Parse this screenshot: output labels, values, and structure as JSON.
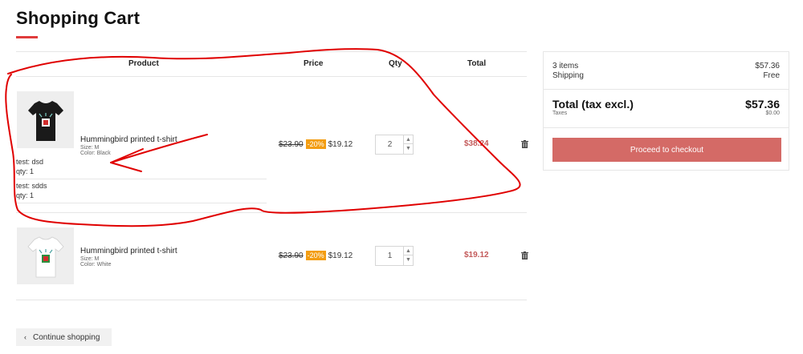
{
  "page": {
    "title": "Shopping Cart"
  },
  "table": {
    "headers": {
      "product": "Product",
      "price": "Price",
      "qty": "Qty",
      "total": "Total"
    }
  },
  "items": [
    {
      "name": "Hummingbird printed t-shirt",
      "size": "Size: M",
      "color": "Color: Black",
      "shirt_color": "#1a1a1a",
      "customizations": [
        {
          "label": "test: dsd",
          "qty": "qty: 1"
        },
        {
          "label": "test: sdds",
          "qty": "qty: 1"
        }
      ],
      "old_price": "$23.90",
      "discount": "-20%",
      "new_price": "$19.12",
      "quantity": "2",
      "line_total": "$38.24"
    },
    {
      "name": "Hummingbird printed t-shirt",
      "size": "Size: M",
      "color": "Color: White",
      "shirt_color": "#f4f4f4",
      "old_price": "$23.90",
      "discount": "-20%",
      "new_price": "$19.12",
      "quantity": "1",
      "line_total": "$19.12"
    }
  ],
  "summary": {
    "items_label": "3 items",
    "items_value": "$57.36",
    "shipping_label": "Shipping",
    "shipping_value": "Free",
    "total_label": "Total (tax excl.)",
    "total_value": "$57.36",
    "taxes_label": "Taxes",
    "taxes_value": "$0.00",
    "checkout_label": "Proceed to checkout"
  },
  "continue_label": "Continue shopping",
  "colors": {
    "accent": "#e03c3c",
    "checkout": "#d46a66",
    "discount": "#f39d12",
    "line_total": "#c35a5a",
    "annotation": "#e00000"
  },
  "icons": [
    "trash-icon",
    "chevron-left-icon",
    "chevron-up-icon",
    "chevron-down-icon"
  ]
}
